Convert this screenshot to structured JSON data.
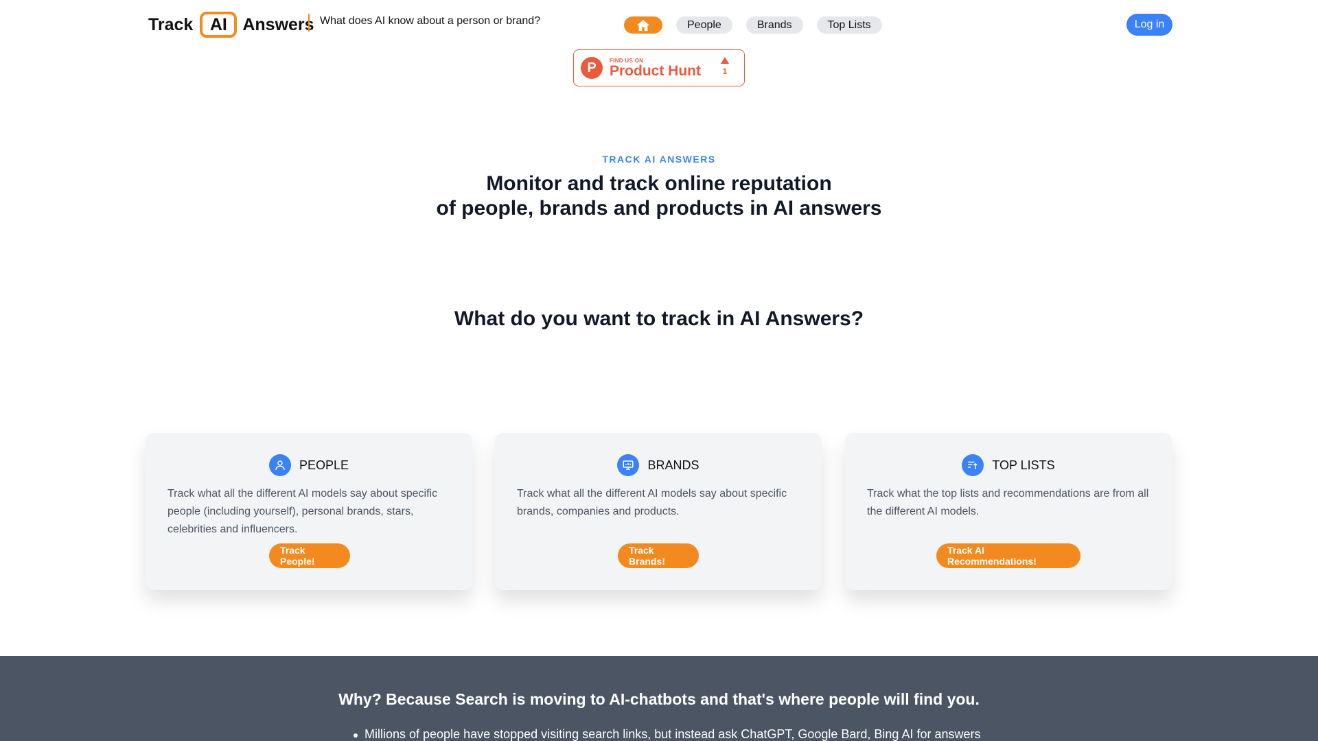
{
  "header": {
    "logo_track": "Track",
    "logo_ai": "AI",
    "logo_answers": "Answers",
    "tagline": "What does AI know about a person or brand?",
    "nav": [
      {
        "label": "People"
      },
      {
        "label": "Brands"
      },
      {
        "label": "Top Lists"
      }
    ],
    "login_label": "Log in"
  },
  "product_hunt": {
    "small": "FIND US ON",
    "big": "Product Hunt",
    "logo_letter": "P",
    "votes": "1"
  },
  "hero": {
    "eyebrow": "TRACK AI ANSWERS",
    "title_line1": "Monitor and track online reputation",
    "title_line2": "of people, brands and products in AI answers"
  },
  "question": "What do you want to track in AI Answers?",
  "cards": [
    {
      "icon": "person-icon",
      "title": "PEOPLE",
      "description": "Track what all the different AI models say about specific people (including yourself), personal brands, stars, celebrities and influencers.",
      "button": "Track People!"
    },
    {
      "icon": "presentation-chart-icon",
      "title": "BRANDS",
      "description": "Track what all the different AI models say about specific brands, companies and products.",
      "button": "Track Brands!"
    },
    {
      "icon": "sort-list-icon",
      "title": "TOP LISTS",
      "description": "Track what the top lists and recommendations are from all the different AI models.",
      "button": "Track AI Recommendations!"
    }
  ],
  "band": {
    "title": "Why? Because Search is moving to AI-chatbots and that's where people will find you.",
    "bullets": [
      "Millions of people have stopped visiting search links, but instead ask ChatGPT, Google Bard, Bing AI for answers"
    ]
  },
  "colors": {
    "accent_orange": "#f28a1f",
    "accent_blue": "#3b82f6",
    "product_hunt_red": "#ea5a3d",
    "band_gray": "#4b5563"
  }
}
